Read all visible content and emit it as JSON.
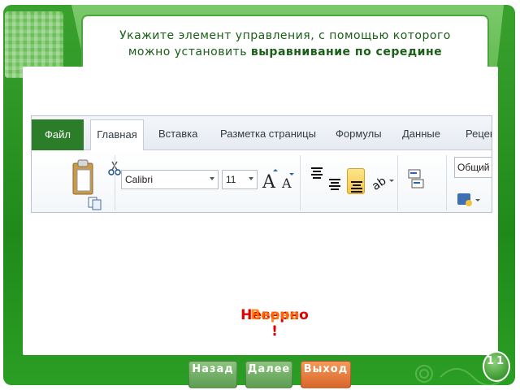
{
  "slide": {
    "title_plain": "Укажите элемент управления, с помощью которого можно установить ",
    "title_bold": "выравнивание по середине",
    "page_number": "11"
  },
  "ribbon": {
    "tabs": {
      "file": "Файл",
      "home": "Главная",
      "insert": "Вставка",
      "page_layout": "Разметка страницы",
      "formulas": "Формулы",
      "data": "Данные",
      "review": "Рецен"
    },
    "font_name": "Calibri",
    "font_size": "11",
    "number_format": "Общий"
  },
  "feedback": {
    "wrong": "Неверно",
    "right": "Верно",
    "exclamation": "!"
  },
  "nav": {
    "back": "Назад",
    "next": "Далее",
    "exit": "Выход"
  },
  "colors": {
    "frame_green": "#2b9e24",
    "title_text": "#1a5e17",
    "highlight_button": "#f6c646",
    "exit_button": "#d9662a",
    "wrong_text": "#e00000"
  }
}
